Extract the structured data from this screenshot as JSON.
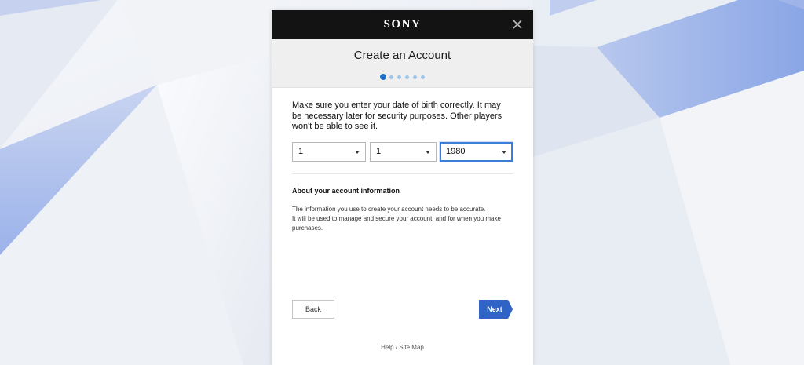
{
  "brand": {
    "logo_text": "SONY"
  },
  "dialog": {
    "title": "Create an Account",
    "steps": {
      "total": 6,
      "current": 1
    },
    "intro_text": "Make sure you enter your date of birth correctly. It may be necessary later for security purposes. Other players won't be able to see it.",
    "dob": {
      "day": "1",
      "month": "1",
      "year": "1980"
    },
    "info": {
      "heading": "About your account information",
      "line1": "The information you use to create your account needs to be accurate.",
      "line2": "It will be used to manage and secure your account, and for when you make purchases."
    },
    "buttons": {
      "back": "Back",
      "next": "Next"
    },
    "footer": {
      "help": "Help",
      "separator": " / ",
      "site_map": "Site Map"
    }
  },
  "colors": {
    "header_bg": "#131313",
    "accent": "#2f63c6",
    "step_active": "#1e6fc9",
    "step_inactive": "#9ec5e8"
  },
  "icons": {
    "close": "close-icon",
    "dropdown": "chevron-down-icon"
  }
}
